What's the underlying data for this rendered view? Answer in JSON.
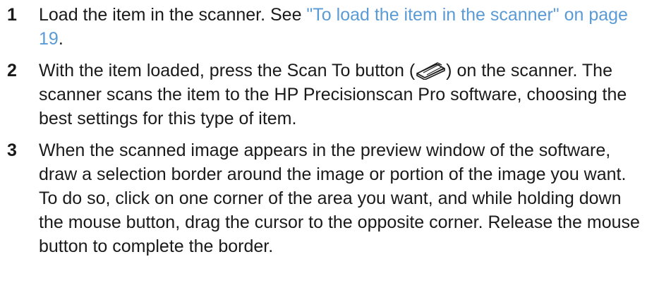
{
  "steps": [
    {
      "number": "1",
      "text_before": "Load the item in the scanner. See ",
      "link": "\"To load the item in the scanner\" on page 19",
      "text_after": "."
    },
    {
      "number": "2",
      "text_before": "With the item loaded, press the Scan To button (",
      "icon": "scanner-icon",
      "text_after": ") on the scanner. The scanner scans the item to the HP Precisionscan Pro software, choosing the best settings for this type of item."
    },
    {
      "number": "3",
      "text": "When the scanned image appears in the preview window of the software, draw a selection border around the image or portion of the image you want. To do so, click on one corner of the area you want, and while holding down the mouse button, drag the cursor to the opposite corner. Release the mouse button to complete the border."
    }
  ],
  "colors": {
    "text": "#1a1a1a",
    "link": "#5b9bd5"
  }
}
